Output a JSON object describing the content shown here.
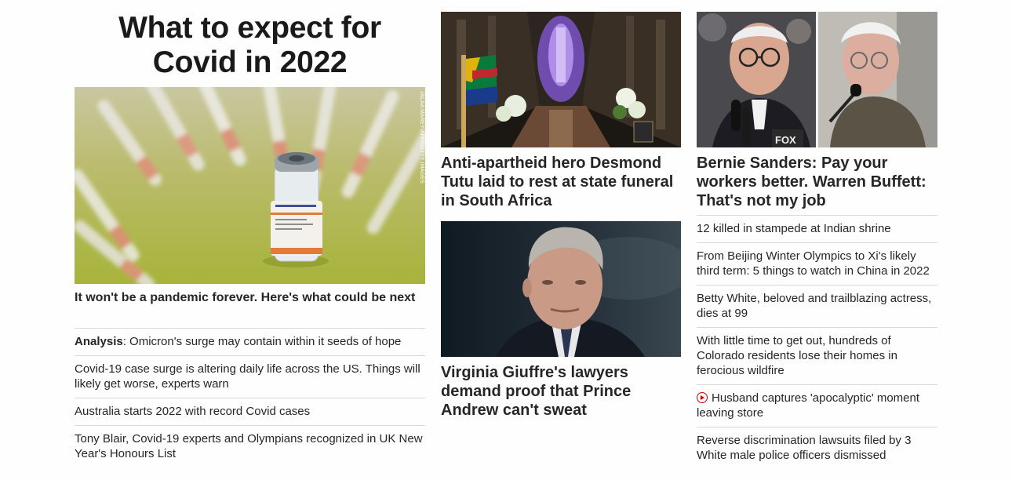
{
  "left": {
    "headline_line1": "What to expect for",
    "headline_line2": "Covid in 2022",
    "hero_credit": "JALAA MAREY/AFP/GETTY IMAGES",
    "hero_caption": "It won't be a pandemic forever. Here's what could be next",
    "items": [
      {
        "prefix": "Analysis",
        "text": ": Omicron's surge may contain within it seeds of hope"
      },
      {
        "prefix": "",
        "text": "Covid-19 case surge is altering daily life across the US. Things will likely get worse, experts warn"
      },
      {
        "prefix": "",
        "text": "Australia starts 2022 with record Covid cases"
      },
      {
        "prefix": "",
        "text": "Tony Blair, Covid-19 experts and Olympians recognized in UK New Year's Honours List"
      }
    ]
  },
  "middle": {
    "card1_title": "Anti-apartheid hero Desmond Tutu laid to rest at state funeral in South Africa",
    "card2_title": "Virginia Giuffre's lawyers demand proof that Prince Andrew can't sweat"
  },
  "right": {
    "card_title": "Bernie Sanders: Pay your workers better. Warren Buffett: That's not my job",
    "mic_label": "FOX",
    "items": [
      {
        "video": false,
        "text": "12 killed in stampede at Indian shrine"
      },
      {
        "video": false,
        "text": "From Beijing Winter Olympics to Xi's likely third term: 5 things to watch in China in 2022"
      },
      {
        "video": false,
        "text": "Betty White, beloved and trailblazing actress, dies at 99"
      },
      {
        "video": false,
        "text": "With little time to get out, hundreds of Colorado residents lose their homes in ferocious wildfire"
      },
      {
        "video": true,
        "text": "Husband captures 'apocalyptic' moment leaving store"
      },
      {
        "video": false,
        "text": "Reverse discrimination lawsuits filed by 3 White male police officers dismissed"
      }
    ]
  },
  "colors": {
    "text": "#262626",
    "divider": "#d8d8d8",
    "video_icon": "#cc0000"
  }
}
